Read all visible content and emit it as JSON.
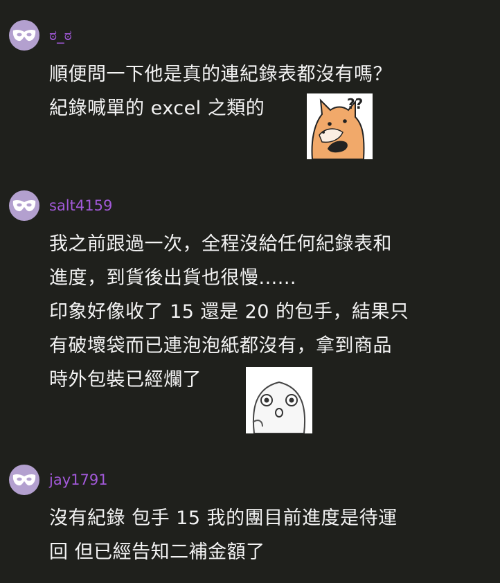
{
  "comments": [
    {
      "username": "ಠ_ಠ",
      "lines": [
        "順便問一下他是真的連紀錄表都沒有嗎？",
        "紀錄喊單的 excel 之類的"
      ],
      "sticker": "fox-question-sticker"
    },
    {
      "username": "salt4159",
      "lines": [
        "我之前跟過一次，全程沒給任何紀錄表和",
        "進度，到貨後出貨也很慢......",
        "印象好像收了 15 還是 20 的包手，結果只",
        "有破壞袋而已連泡泡紙都沒有，拿到商品",
        "時外包裝已經爛了"
      ],
      "sticker": "shocked-blob-sticker"
    },
    {
      "username": "jay1791",
      "lines": [
        "沒有紀錄 包手 15 我的團目前進度是待運",
        "回 但已經告知二補金額了"
      ]
    }
  ],
  "colors": {
    "background": "#1f201c",
    "username": "#a259d9",
    "avatar": "#b3a0cf",
    "text": "#f3f3f3"
  },
  "icons": {
    "avatar": "anonymous-mask-icon"
  }
}
